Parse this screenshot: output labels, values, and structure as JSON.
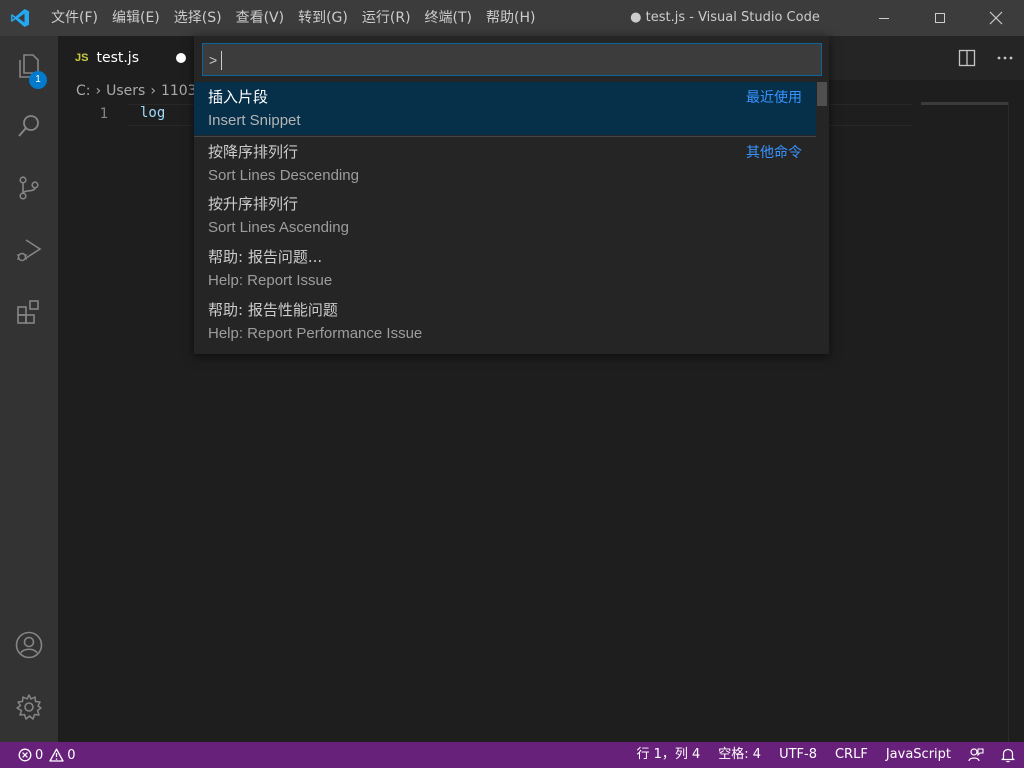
{
  "window": {
    "title": "● test.js - Visual Studio Code",
    "controls": [
      "minimize",
      "maximize",
      "close"
    ]
  },
  "menu": [
    {
      "label": "文件(F)"
    },
    {
      "label": "编辑(E)"
    },
    {
      "label": "选择(S)"
    },
    {
      "label": "查看(V)"
    },
    {
      "label": "转到(G)"
    },
    {
      "label": "运行(R)"
    },
    {
      "label": "终端(T)"
    },
    {
      "label": "帮助(H)"
    }
  ],
  "activity_bar": {
    "explorer_badge": "1",
    "icons": [
      "files-icon",
      "search-icon",
      "source-control-icon",
      "run-debug-icon",
      "extensions-icon",
      "account-icon",
      "settings-gear-icon"
    ]
  },
  "tab": {
    "lang_badge": "JS",
    "file_name": "test.js",
    "dirty": true
  },
  "breadcrumb": [
    "C:",
    "Users",
    "1103"
  ],
  "editor": {
    "line_number": "1",
    "code": "log"
  },
  "palette": {
    "input_value": ">",
    "items": [
      {
        "label": "插入片段",
        "detail": "Insert Snippet",
        "kind": "最近使用",
        "selected": true
      },
      {
        "label": "按降序排列行",
        "detail": "Sort Lines Descending",
        "kind": "其他命令",
        "selected": false
      },
      {
        "label": "按升序排列行",
        "detail": "Sort Lines Ascending",
        "kind": "",
        "selected": false
      },
      {
        "label": "帮助: 报告问题...",
        "detail": "Help: Report Issue",
        "kind": "",
        "selected": false
      },
      {
        "label": "帮助: 报告性能问题",
        "detail": "Help: Report Performance Issue",
        "kind": "",
        "selected": false
      }
    ]
  },
  "status_bar": {
    "errors": "0",
    "warnings": "0",
    "cursor": "行 1，列 4",
    "spaces": "空格: 4",
    "encoding": "UTF-8",
    "eol": "CRLF",
    "language": "JavaScript"
  },
  "colors": {
    "status_bar": "#68217a",
    "accent": "#007acc",
    "palette_selection": "#062f4a",
    "kind_label": "#3794ff"
  }
}
